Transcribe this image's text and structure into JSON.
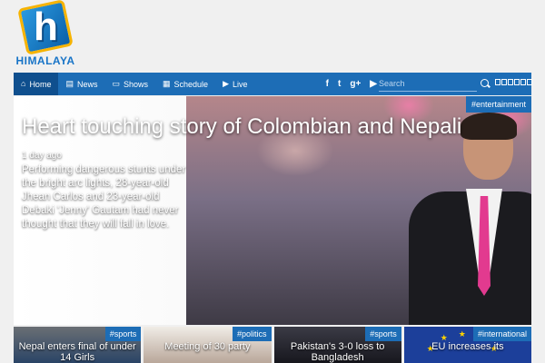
{
  "logo": {
    "text": "HIMALAYA",
    "mark": "h"
  },
  "nav": {
    "items": [
      {
        "label": "Home",
        "icon": "home-icon"
      },
      {
        "label": "News",
        "icon": "news-icon"
      },
      {
        "label": "Shows",
        "icon": "monitor-icon"
      },
      {
        "label": "Schedule",
        "icon": "calendar-icon"
      },
      {
        "label": "Live",
        "icon": "play-icon"
      }
    ],
    "social": {
      "facebook": "f",
      "twitter": "t",
      "google": "g+",
      "youtube": "▶"
    },
    "search_placeholder": "Search"
  },
  "hero": {
    "tag": "#entertainment",
    "title": "Heart touching story of Colombian and Nepali",
    "time": "1 day ago",
    "description": "Performing dangerous stunts under the bright arc lights, 28-year-old Jhean Carlos and 23-year-old Debaki 'Jenny' Gautam had never thought that they will fall in love."
  },
  "cards": [
    {
      "tag": "#sports",
      "title": "Nepal enters final of under 14 Girls"
    },
    {
      "tag": "#politics",
      "title": "Meeting of 30 party"
    },
    {
      "tag": "#sports",
      "title": "Pakistan's 3-0 loss to Bangladesh"
    },
    {
      "tag": "#international",
      "title": "EU increases its"
    }
  ],
  "colors": {
    "brand": "#1d6db6",
    "nav_active": "#0f4f8e",
    "logo_accent": "#f6b300"
  }
}
